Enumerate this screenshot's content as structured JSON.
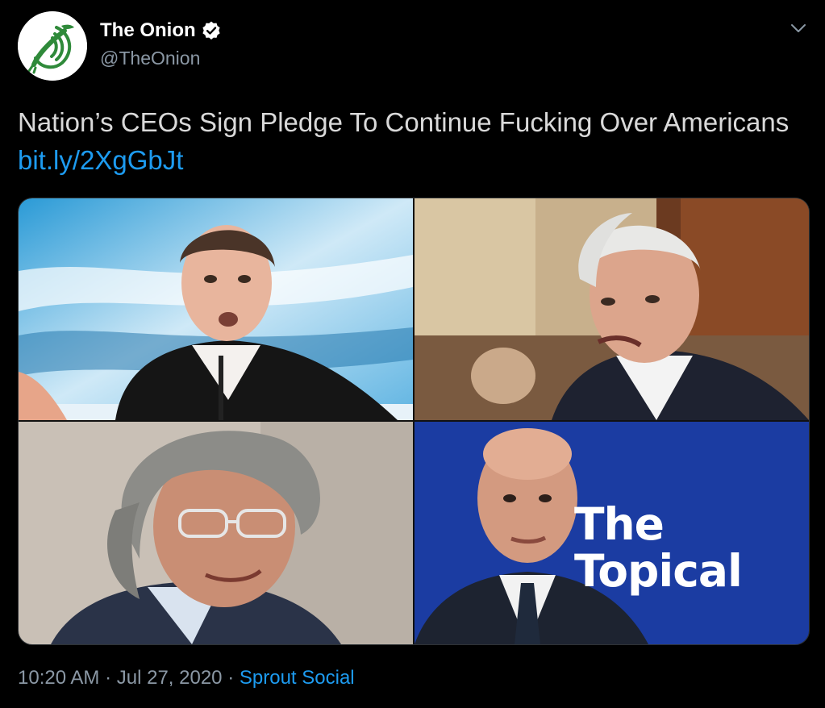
{
  "account": {
    "display_name": "The Onion",
    "handle": "@TheOnion",
    "verified": true,
    "avatar_icon": "onion-logo-icon"
  },
  "tweet": {
    "text": "Nation’s CEOs Sign Pledge To Continue Fucking Over Americans",
    "link": "bit.ly/2XgGbJt"
  },
  "media": {
    "photos": [
      {
        "name": "photo-top-left",
        "description_icon": "ceo-portrait"
      },
      {
        "name": "photo-top-right",
        "description_icon": "ceo-portrait"
      },
      {
        "name": "photo-bottom-left",
        "description_icon": "ceo-portrait"
      },
      {
        "name": "photo-bottom-right",
        "description_icon": "ceo-portrait"
      }
    ],
    "overlay_line1": "The",
    "overlay_line2": "Topical"
  },
  "footer": {
    "time": "10:20 AM",
    "separator": "·",
    "date": "Jul 27, 2020",
    "source": "Sprout Social"
  },
  "colors": {
    "background": "#000000",
    "link": "#1d9bf0",
    "secondary_text": "#8b98a5",
    "brand_green": "#2f8a3a",
    "topical_blue": "#1d3fa8"
  }
}
